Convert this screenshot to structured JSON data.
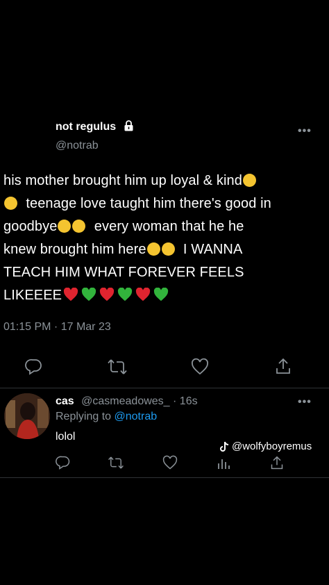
{
  "tweet": {
    "display_name": "not regulus",
    "handle": "@notrab",
    "text_lines": [
      "his mother brought him up loyal & kind",
      "teenage love taught him there's good in",
      "goodbye",
      "every woman that he he",
      "knew brought him here",
      "I WANNA",
      "TEACH HIM WHAT FOREVER FEELS",
      "LIKEEEE"
    ],
    "timestamp": "01:15 PM · 17 Mar 23",
    "more": "•••"
  },
  "reply": {
    "display_name": "cas",
    "handle": "@casmeadowes_",
    "time": "· 16s",
    "replying_prefix": "Replying to",
    "replying_handle": "@notrab",
    "text": "lolol",
    "more": "•••"
  },
  "watermark": {
    "text": "@wolfyboyremus"
  },
  "colors": {
    "background": "#000000",
    "muted": "#8b9298",
    "link": "#1d9bf0",
    "divider": "#2f3336"
  }
}
